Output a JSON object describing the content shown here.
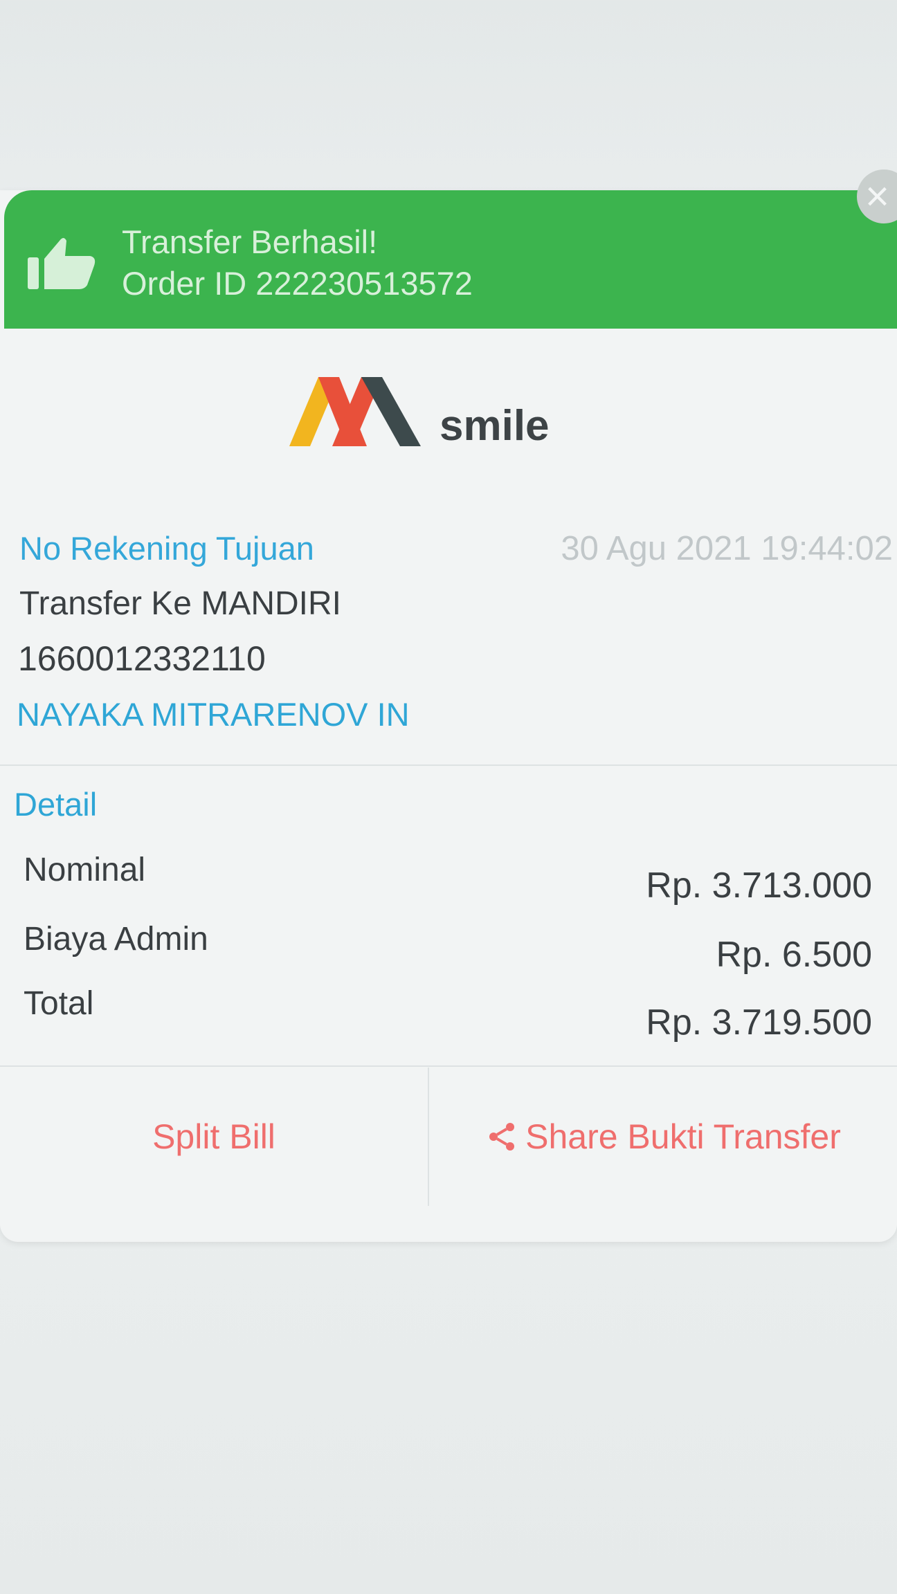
{
  "header": {
    "title": "Transfer Berhasil!",
    "order_id": "Order ID 222230513572",
    "close_label": "×"
  },
  "logo": {
    "word": "smile"
  },
  "recipient": {
    "label": "No Rekening Tujuan",
    "timestamp": "30 Agu 2021 19:44:02",
    "bank": "Transfer Ke MANDIRI",
    "account_number": "1660012332110",
    "account_name": "NAYAKA MITRARENOV IN"
  },
  "detail": {
    "label": "Detail",
    "rows": [
      {
        "label": "Nominal",
        "value": "Rp. 3.713.000"
      },
      {
        "label": "Biaya Admin",
        "value": "Rp. 6.500"
      },
      {
        "label": "Total",
        "value": "Rp. 3.719.500"
      }
    ]
  },
  "actions": {
    "split_bill": "Split Bill",
    "share": "Share Bukti Transfer"
  },
  "colors": {
    "success_green": "#3cb44e",
    "link_blue": "#2fa6d6",
    "action_red": "#ef6e6d",
    "logo_yellow": "#f2b51f",
    "logo_red": "#e8503a",
    "logo_dark": "#3d4a4c"
  }
}
